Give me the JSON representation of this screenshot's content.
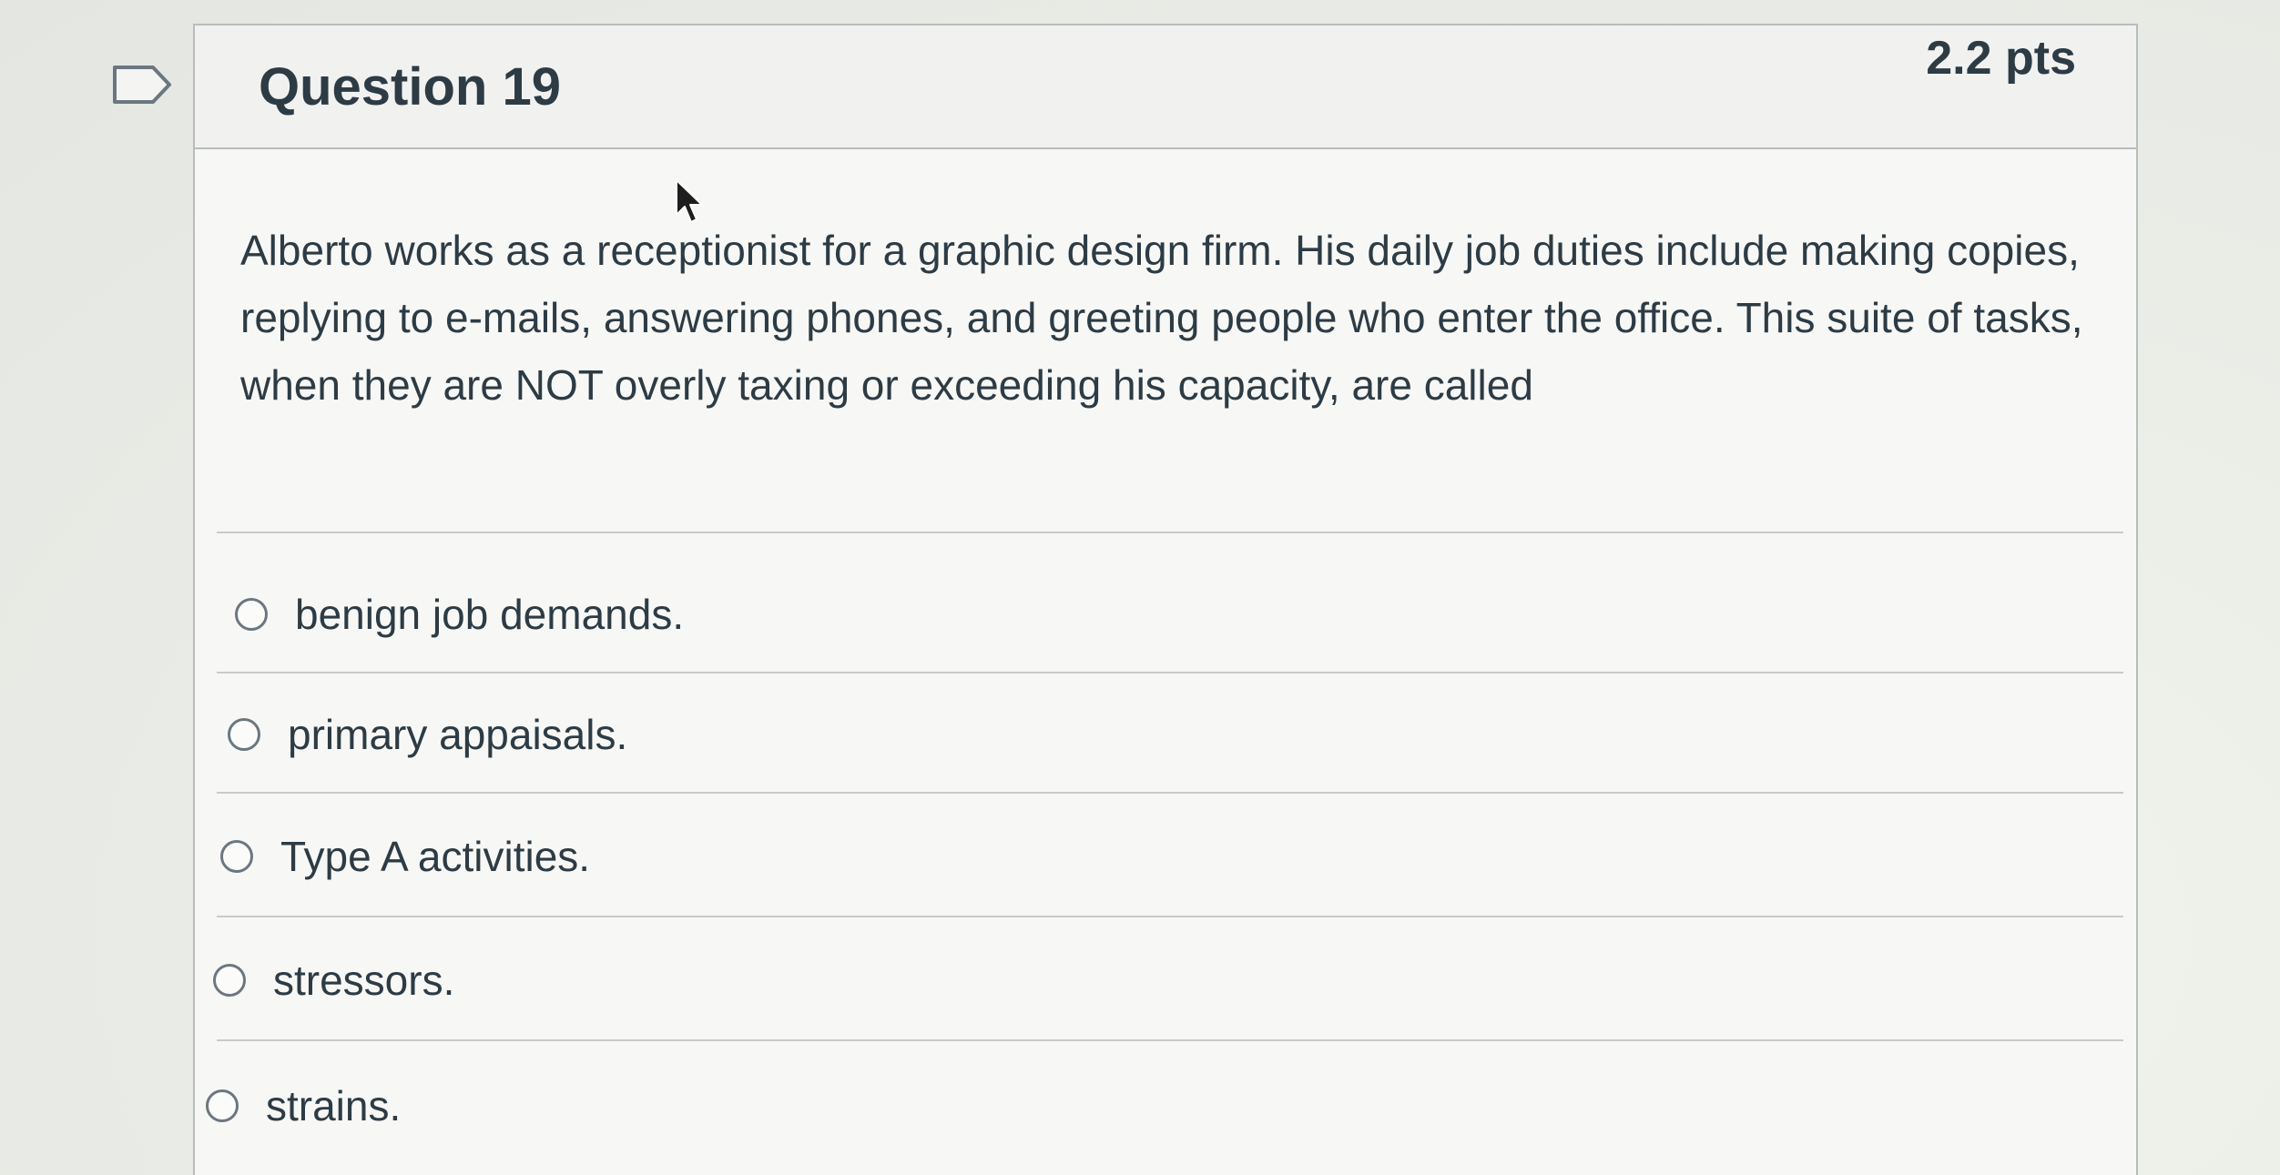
{
  "question": {
    "title": "Question 19",
    "points": "2.2 pts",
    "text": "Alberto works as a receptionist for a graphic design firm. His daily job duties include making copies, replying to e-mails, answering phones, and greeting people who enter the office. This suite of tasks, when they are NOT overly taxing or exceeding his capacity, are called"
  },
  "answers": [
    {
      "label": "benign job demands."
    },
    {
      "label": "primary appaisals."
    },
    {
      "label": "Type A activities."
    },
    {
      "label": "stressors."
    },
    {
      "label": "strains."
    }
  ],
  "icons": {
    "flag": "bookmark-flag-icon",
    "cursor": "mouse-pointer-icon",
    "radio": "radio-unselected-icon"
  },
  "colors": {
    "text": "#2d3b45",
    "border": "#b8bcbd",
    "header_bg": "#f1f2f0"
  }
}
